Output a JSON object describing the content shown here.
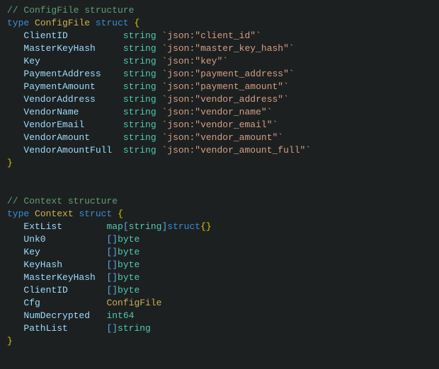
{
  "comment1": "// ConfigFile structure",
  "kw_type": "type",
  "kw_struct": "struct",
  "lbrace": "{",
  "rbrace": "}",
  "struct1": {
    "name": "ConfigFile",
    "fields": [
      {
        "name": "ClientID",
        "type": "string",
        "tag": "`json:\"client_id\"`"
      },
      {
        "name": "MasterKeyHash",
        "type": "string",
        "tag": "`json:\"master_key_hash\"`"
      },
      {
        "name": "Key",
        "type": "string",
        "tag": "`json:\"key\"`"
      },
      {
        "name": "PaymentAddress",
        "type": "string",
        "tag": "`json:\"payment_address\"`"
      },
      {
        "name": "PaymentAmount",
        "type": "string",
        "tag": "`json:\"payment_amount\"`"
      },
      {
        "name": "VendorAddress",
        "type": "string",
        "tag": "`json:\"vendor_address\"`"
      },
      {
        "name": "VendorName",
        "type": "string",
        "tag": "`json:\"vendor_name\"`"
      },
      {
        "name": "VendorEmail",
        "type": "string",
        "tag": "`json:\"vendor_email\"`"
      },
      {
        "name": "VendorAmount",
        "type": "string",
        "tag": "`json:\"vendor_amount\"`"
      },
      {
        "name": "VendorAmountFull",
        "type": "string",
        "tag": "`json:\"vendor_amount_full\"`"
      }
    ]
  },
  "comment2": "// Context structure",
  "struct2": {
    "name": "Context",
    "fields": [
      {
        "name": "ExtList",
        "pre": "",
        "keytype": "string",
        "post": "struct",
        "tail": "{}",
        "kind": "map"
      },
      {
        "name": "Unk0",
        "pre": "[]",
        "type": "byte",
        "kind": "slice"
      },
      {
        "name": "Key",
        "pre": "[]",
        "type": "byte",
        "kind": "slice"
      },
      {
        "name": "KeyHash",
        "pre": "[]",
        "type": "byte",
        "kind": "slice"
      },
      {
        "name": "MasterKeyHash",
        "pre": "[]",
        "type": "byte",
        "kind": "slice"
      },
      {
        "name": "ClientID",
        "pre": "[]",
        "type": "byte",
        "kind": "slice"
      },
      {
        "name": "Cfg",
        "type": "ConfigFile",
        "kind": "named"
      },
      {
        "name": "NumDecrypted",
        "type": "int64",
        "kind": "prim"
      },
      {
        "name": "PathList",
        "pre": "[]",
        "type": "string",
        "kind": "slice"
      }
    ]
  },
  "kw_map": "map"
}
